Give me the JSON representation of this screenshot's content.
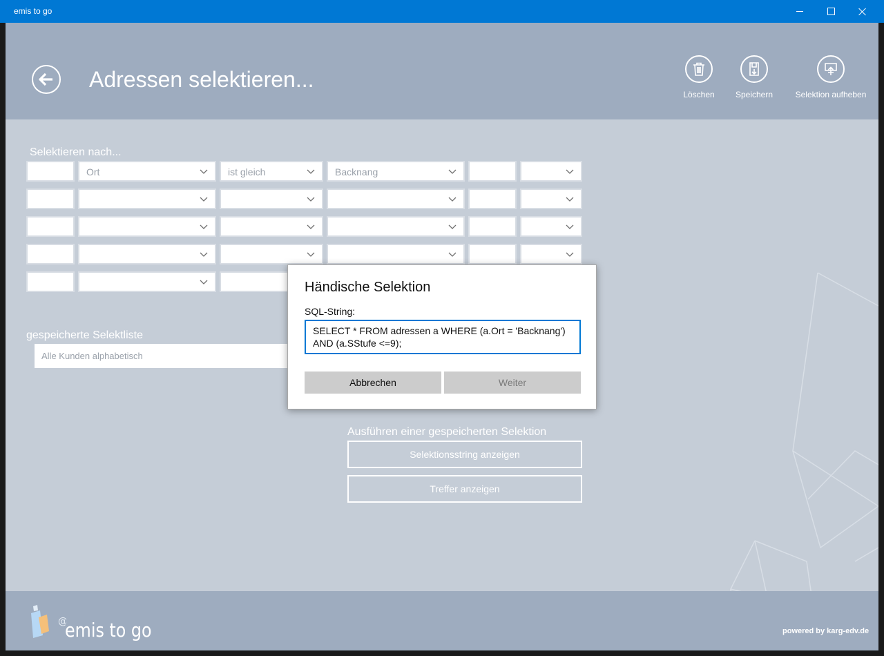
{
  "window": {
    "title": "emis to go"
  },
  "header": {
    "title": "Adressen selektieren...",
    "buttons": {
      "delete": "Löschen",
      "save": "Speichern",
      "clear_selection": "Selektion aufheben"
    }
  },
  "selection": {
    "label": "Selektieren nach...",
    "rows": [
      {
        "field": "Ort",
        "operator": "ist gleich",
        "value": "Backnang"
      },
      {
        "field": "",
        "operator": "",
        "value": ""
      },
      {
        "field": "",
        "operator": "",
        "value": ""
      },
      {
        "field": "",
        "operator": "",
        "value": ""
      },
      {
        "field": "",
        "operator": "",
        "value": ""
      }
    ]
  },
  "saved": {
    "label": "gespeicherte Selektliste",
    "selected": "Alle Kunden alphabetisch"
  },
  "execute": {
    "label": "Ausführen einer gespeicherten Selektion",
    "show_string": "Selektionsstring anzeigen",
    "show_hits": "Treffer anzeigen"
  },
  "dialog": {
    "title": "Händische Selektion",
    "sql_label": "SQL-String:",
    "sql_line1": "SELECT * FROM adressen a WHERE  (a.Ort = 'Backnang')",
    "sql_line2": "AND (a.SStufe <=9);",
    "cancel": "Abbrechen",
    "next": "Weiter"
  },
  "footer": {
    "logo_text": "emis to go",
    "powered": "powered by karg-edv.de"
  },
  "icons": [
    "back-arrow-icon",
    "trash-icon",
    "save-icon",
    "upload-icon",
    "chevron-down-icon",
    "logo-icon"
  ],
  "colors": {
    "titlebar": "#0078d4",
    "header": "#9eacbf",
    "background": "#c5cdd7",
    "accent": "#0078d4"
  }
}
